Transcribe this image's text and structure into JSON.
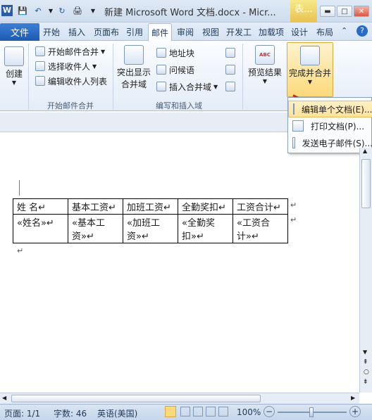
{
  "window": {
    "title": "新建 Microsoft Word 文档.docx - Micr...",
    "context_tab": "表...",
    "word_icon": "W"
  },
  "quick_access": {
    "save": "save-icon",
    "undo": "undo-icon",
    "redo": "redo-icon",
    "print": "print-icon"
  },
  "tabs": {
    "file": "文件",
    "items": [
      "开始",
      "插入",
      "页面布",
      "引用",
      "邮件",
      "审阅",
      "视图",
      "开发工",
      "加载项",
      "设计",
      "布局"
    ],
    "active": "邮件"
  },
  "ribbon": {
    "create": {
      "label": "创建"
    },
    "start_merge": {
      "group_label": "开始邮件合并",
      "start": "开始邮件合并",
      "select": "选择收件人",
      "edit_list": "编辑收件人列表"
    },
    "write_insert": {
      "group_label": "编写和插入域",
      "highlight": "突出显示",
      "highlight2": "合并域",
      "address_block": "地址块",
      "greeting": "问候语",
      "insert_field": "插入合并域"
    },
    "preview": {
      "label": "预览结果",
      "abc": "ABC"
    },
    "finish": {
      "label": "完成并合并"
    }
  },
  "finish_menu": {
    "items": [
      "编辑单个文档(E)...",
      "打印文档(P)...",
      "发送电子邮件(S)..."
    ]
  },
  "table": {
    "headers": [
      "姓 名↵",
      "基本工资↵",
      "加班工资↵",
      "全勤奖扣↵",
      "工资合计↵"
    ],
    "row": [
      "«姓名»↵",
      "«基本工资»↵",
      "«加班工资»↵",
      "«全勤奖扣»↵",
      "«工资合计»↵"
    ],
    "row_end": "↵"
  },
  "doc": {
    "para_mark": "↵"
  },
  "status": {
    "page": "页面: 1/1",
    "words": "字数: 46",
    "lang": "英语(美国)",
    "zoom": "100%",
    "zoom_minus": "−",
    "zoom_plus": "+"
  }
}
